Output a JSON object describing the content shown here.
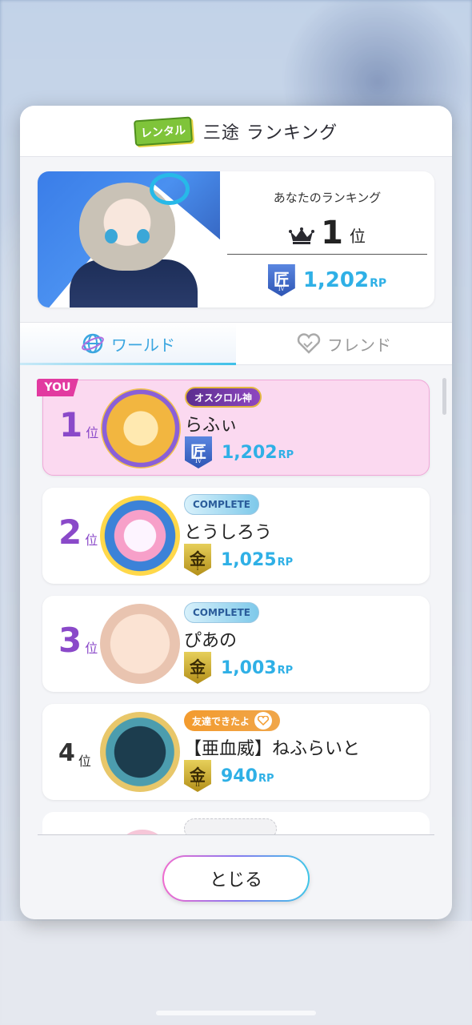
{
  "modal": {
    "badge": "レンタル",
    "title": "三途 ランキング"
  },
  "my_ranking": {
    "label": "あなたのランキング",
    "rank": "1",
    "rank_unit": "位",
    "badge_char": "匠",
    "badge_tier": "IV",
    "rp": "1,202",
    "rp_unit": "RP"
  },
  "tabs": {
    "world": "ワールド",
    "friend": "フレンド",
    "active": "world"
  },
  "you_tag": "YOU",
  "rows": [
    {
      "rank": "1",
      "unit": "位",
      "title": "オスクロル神",
      "name": "らふぃ",
      "badge_char": "匠",
      "badge_tier": "IV",
      "rp": "1,202",
      "rp_unit": "RP"
    },
    {
      "rank": "2",
      "unit": "位",
      "title": "COMPLETE",
      "name": "とうしろう",
      "badge_char": "金",
      "badge_tier": "I",
      "rp": "1,025",
      "rp_unit": "RP"
    },
    {
      "rank": "3",
      "unit": "位",
      "title": "COMPLETE",
      "name": "ぴあの",
      "badge_char": "金",
      "badge_tier": "I",
      "rp": "1,003",
      "rp_unit": "RP"
    },
    {
      "rank": "4",
      "unit": "位",
      "title": "友達できたよ",
      "name": "【亜血威】ねふらいと",
      "badge_char": "金",
      "badge_tier": "II",
      "rp": "940",
      "rp_unit": "RP"
    }
  ],
  "close_button": "とじる",
  "colors": {
    "accent_blue": "#2fb0e6",
    "rank_purple": "#8a49c9",
    "you_pink": "#e23aa0"
  }
}
